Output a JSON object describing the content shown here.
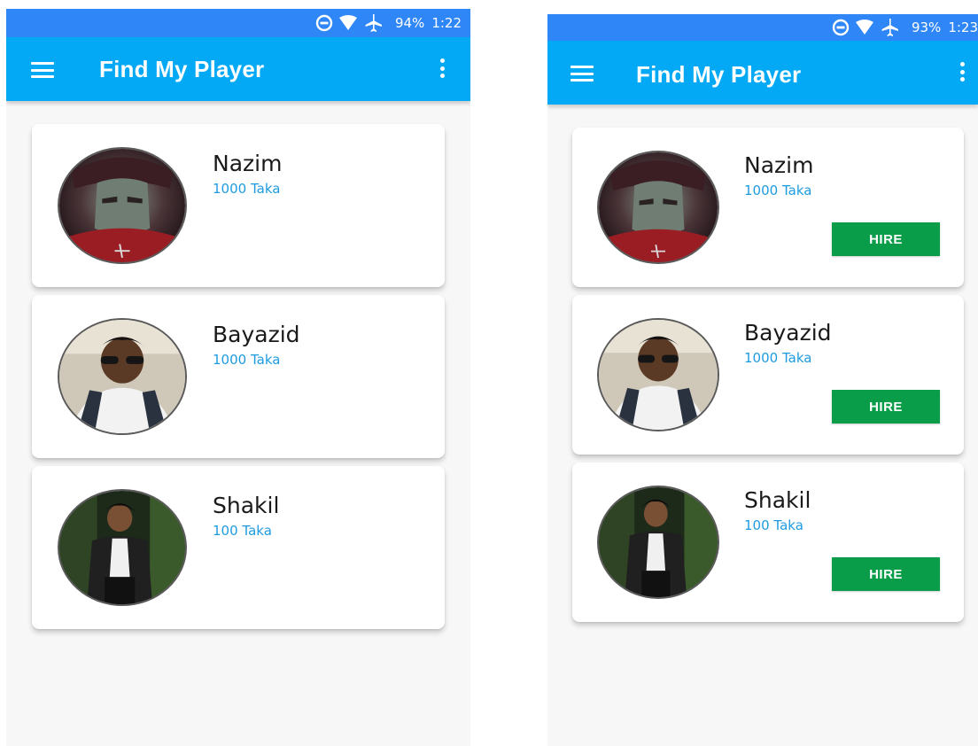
{
  "screens": [
    {
      "status_bar": {
        "battery": "94%",
        "time": "1:22"
      },
      "app_bar": {
        "title": "Find My Player",
        "menu_icon": "hamburger-menu-icon",
        "more_icon": "more-vertical-icon"
      },
      "players": [
        {
          "name": "Nazim",
          "price": "1000 Taka"
        },
        {
          "name": "Bayazid",
          "price": "1000 Taka"
        },
        {
          "name": "Shakil",
          "price": "100 Taka"
        }
      ]
    },
    {
      "status_bar": {
        "battery": "93%",
        "time": "1:23"
      },
      "app_bar": {
        "title": "Find My Player",
        "menu_icon": "hamburger-menu-icon",
        "more_icon": "more-vertical-icon"
      },
      "players": [
        {
          "name": "Nazim",
          "price": "1000 Taka",
          "button_label": "HIRE"
        },
        {
          "name": "Bayazid",
          "price": "1000 Taka",
          "button_label": "HIRE"
        },
        {
          "name": "Shakil",
          "price": "100 Taka",
          "button_label": "HIRE"
        }
      ]
    }
  ],
  "colors": {
    "status_bar": "#2f86f6",
    "app_bar": "#03a9f4",
    "price_text": "#1e9be0",
    "hire_button": "#0a9d49",
    "background": "#f7f7f7"
  }
}
